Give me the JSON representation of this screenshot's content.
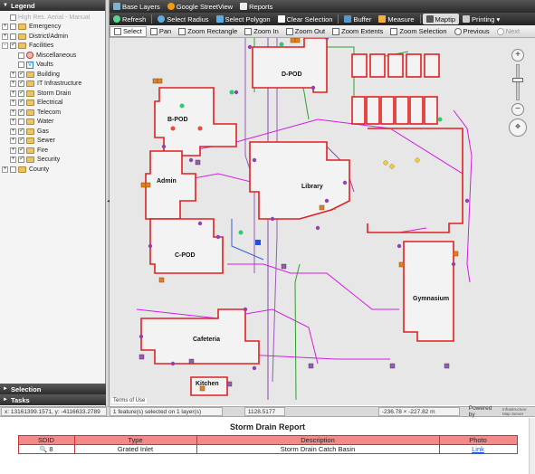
{
  "legend": {
    "title": "Legend",
    "items": [
      {
        "label": "High Res. Aerial - Manual",
        "level": 0,
        "expand": "",
        "checked": false,
        "icon": "none",
        "disabled": true
      },
      {
        "label": "Emergency",
        "level": 0,
        "expand": "+",
        "checked": false,
        "icon": "folder"
      },
      {
        "label": "District/Admin",
        "level": 0,
        "expand": "+",
        "checked": false,
        "icon": "folder"
      },
      {
        "label": "Facilities",
        "level": 0,
        "expand": "-",
        "checked": true,
        "icon": "folder"
      },
      {
        "label": "Miscellaneous",
        "level": 1,
        "expand": "",
        "checked": false,
        "icon": "pink-circle"
      },
      {
        "label": "Vaults",
        "level": 1,
        "expand": "",
        "checked": false,
        "icon": "v-box"
      },
      {
        "label": "Building",
        "level": 1,
        "expand": "+",
        "checked": true,
        "icon": "folder"
      },
      {
        "label": "IT Infrastructure",
        "level": 1,
        "expand": "+",
        "checked": true,
        "icon": "folder"
      },
      {
        "label": "Storm Drain",
        "level": 1,
        "expand": "+",
        "checked": true,
        "icon": "folder"
      },
      {
        "label": "Electrical",
        "level": 1,
        "expand": "+",
        "checked": true,
        "icon": "folder"
      },
      {
        "label": "Telecom",
        "level": 1,
        "expand": "+",
        "checked": true,
        "icon": "folder"
      },
      {
        "label": "Water",
        "level": 1,
        "expand": "+",
        "checked": false,
        "icon": "folder"
      },
      {
        "label": "Gas",
        "level": 1,
        "expand": "+",
        "checked": true,
        "icon": "folder"
      },
      {
        "label": "Sewer",
        "level": 1,
        "expand": "+",
        "checked": true,
        "icon": "folder"
      },
      {
        "label": "Fire",
        "level": 1,
        "expand": "+",
        "checked": true,
        "icon": "folder"
      },
      {
        "label": "Security",
        "level": 1,
        "expand": "+",
        "checked": true,
        "icon": "folder"
      },
      {
        "label": "County",
        "level": 0,
        "expand": "+",
        "checked": false,
        "icon": "folder"
      }
    ]
  },
  "panels": {
    "selection": "Selection",
    "tasks": "Tasks"
  },
  "toolbar1": {
    "base_layers": "Base Layers",
    "streetview": "Google StreetView",
    "reports": "Reports"
  },
  "toolbar2": {
    "refresh": "Refresh",
    "select_radius": "Select Radius",
    "select_polygon": "Select Polygon",
    "clear_selection": "Clear Selection",
    "buffer": "Buffer",
    "measure": "Measure",
    "maptip": "Maptip",
    "printing": "Printing"
  },
  "toolbar3": {
    "select": "Select",
    "pan": "Pan",
    "zoom_rectangle": "Zoom Rectangle",
    "zoom_in": "Zoom In",
    "zoom_out": "Zoom Out",
    "zoom_extents": "Zoom Extents",
    "zoom_selection": "Zoom Selection",
    "previous": "Previous",
    "next": "Next"
  },
  "map": {
    "terms": "Terms of Use",
    "buildings": [
      "D-POD",
      "B-POD",
      "Admin",
      "Library",
      "C-POD",
      "Gymnasium",
      "Cafeteria",
      "Kitchen"
    ]
  },
  "status": {
    "coords": "x: 13161399.1571, y: -4116633.2789",
    "selected": "1 feature(s) selected on 1 layer(s)",
    "scale": "1128.5177",
    "extent": "-236.78 × -227.82 m",
    "powered": "Powered by",
    "brand": "Infrastructure Map Server"
  },
  "report": {
    "title": "Storm Drain Report",
    "columns": [
      "SDID",
      "Type",
      "Description",
      "Photo"
    ],
    "rows": [
      {
        "sdid": "8",
        "type": "Grated Inlet",
        "description": "Storm Drain Catch Basin",
        "photo": "Link"
      }
    ]
  },
  "colors": {
    "building_outline": "#e02020",
    "pipe_magenta": "#d020e0",
    "pipe_green": "#30a030",
    "header_red": "#f28a8a"
  }
}
